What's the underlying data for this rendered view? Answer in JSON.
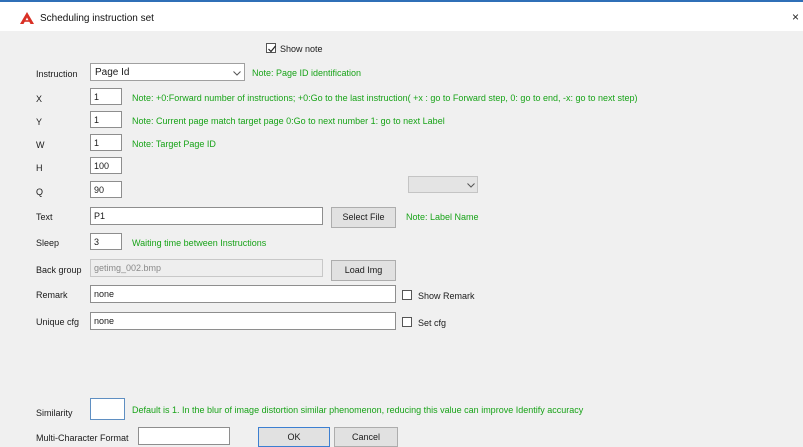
{
  "window": {
    "title": "Scheduling instruction set",
    "close_glyph": "×",
    "accent": "#d93025"
  },
  "show_note": {
    "label": "Show note",
    "checked": true
  },
  "instruction": {
    "label": "Instruction",
    "value": "Page Id",
    "note": "Note: Page ID identification"
  },
  "x": {
    "label": "X",
    "value": "1",
    "note": "Note: +0:Forward number of instructions; +0:Go to the last instruction( +x : go to Forward step, 0: go to end, -x: go to next step)"
  },
  "y": {
    "label": "Y",
    "value": "1",
    "note": "Note: Current page match target page 0:Go to next number 1: go to next Label"
  },
  "w": {
    "label": "W",
    "value": "1",
    "note": "Note: Target Page ID"
  },
  "h": {
    "label": "H",
    "value": "100"
  },
  "q": {
    "label": "Q",
    "value": "90",
    "dropdown_value": ""
  },
  "text": {
    "label": "Text",
    "value": "P1",
    "button": "Select File",
    "note": "Note: Label Name"
  },
  "sleep": {
    "label": "Sleep",
    "value": "3",
    "note": "Waiting time between Instructions"
  },
  "back_group": {
    "label": "Back group",
    "value": "getimg_002.bmp",
    "button": "Load Img"
  },
  "remark": {
    "label": "Remark",
    "value": "none",
    "checkbox_label": "Show Remark",
    "checked": false
  },
  "unique_cfg": {
    "label": "Unique cfg",
    "value": "none",
    "checkbox_label": "Set cfg",
    "checked": false
  },
  "similarity": {
    "label": "Similarity",
    "value": "",
    "note": "Default is 1. In the blur of image distortion similar phenomenon, reducing this value can improve Identify accuracy"
  },
  "multi_char": {
    "label": "Multi-Character Format",
    "value": ""
  },
  "buttons": {
    "ok": "OK",
    "cancel": "Cancel"
  },
  "colors": {
    "note": "#18a318",
    "background": "#f0f0f0"
  }
}
